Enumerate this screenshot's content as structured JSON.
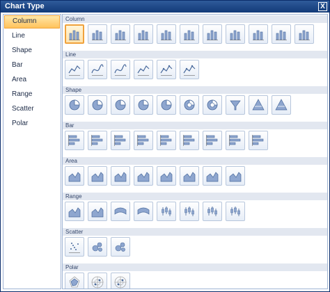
{
  "window": {
    "title": "Chart Type",
    "close_label": "X"
  },
  "sidebar": {
    "items": [
      "Column",
      "Line",
      "Shape",
      "Bar",
      "Area",
      "Range",
      "Scatter",
      "Polar"
    ],
    "active_index": 0
  },
  "sections": [
    {
      "label": "Column",
      "icons": [
        "column-clustered-icon",
        "column-stacked-icon",
        "column-100-stacked-icon",
        "column-3d-clustered-icon",
        "column-3d-stacked-icon",
        "column-3d-100-stacked-icon",
        "column-3d-icon",
        "cylinder-column-icon",
        "cylinder-stacked-icon",
        "cylinder-100-stacked-icon",
        "cylinder-3d-icon"
      ]
    },
    {
      "label": "Line",
      "icons": [
        "line-icon",
        "smooth-line-icon",
        "stepped-line-icon",
        "line-3d-icon",
        "line-markers-icon",
        "line-markers-smooth-icon"
      ]
    },
    {
      "label": "Shape",
      "icons": [
        "pie-icon",
        "exploded-pie-icon",
        "pie-of-pie-icon",
        "pie-3d-icon",
        "exploded-pie-3d-icon",
        "doughnut-icon",
        "exploded-doughnut-icon",
        "funnel-icon",
        "pyramid-icon",
        "pyramid-3d-icon"
      ]
    },
    {
      "label": "Bar",
      "icons": [
        "bar-clustered-icon",
        "bar-stacked-icon",
        "bar-100-stacked-icon",
        "bar-3d-clustered-icon",
        "bar-3d-stacked-icon",
        "bar-3d-100-stacked-icon",
        "bar-cylinder-icon",
        "bar-cylinder-stacked-icon",
        "bar-cylinder-100-icon"
      ]
    },
    {
      "label": "Area",
      "icons": [
        "area-icon",
        "smooth-area-icon",
        "stacked-area-icon",
        "area-100-stacked-icon",
        "area-3d-icon",
        "area-3d-stacked-icon",
        "area-3d-100-stacked-icon",
        "area-3d-filled-icon"
      ]
    },
    {
      "label": "Range",
      "icons": [
        "range-area-icon",
        "smooth-range-area-icon",
        "range-column-icon",
        "range-bar-icon",
        "stock-icon",
        "candlestick-icon",
        "error-bar-icon",
        "box-plot-icon"
      ]
    },
    {
      "label": "Scatter",
      "icons": [
        "scatter-icon",
        "bubble-icon",
        "bubble-3d-icon"
      ]
    },
    {
      "label": "Polar",
      "icons": [
        "radar-icon",
        "polar-icon",
        "polar-3d-icon"
      ]
    }
  ],
  "selected": {
    "section": 0,
    "icon": 0
  },
  "colors": {
    "accent": "#f0a23c",
    "title_bar": "#1f4a8a",
    "section_header": "#e2e7f0",
    "icon_fill": "#8ea6cf",
    "icon_stroke": "#4a6a9c"
  }
}
